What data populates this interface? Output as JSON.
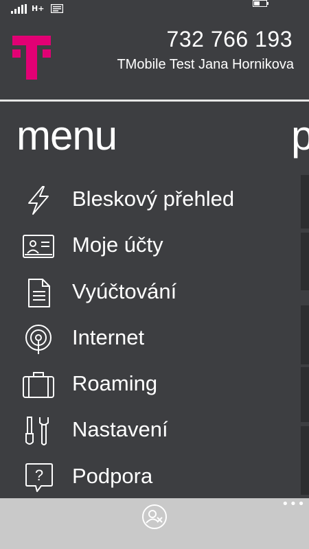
{
  "status_bar": {
    "network_type": "H+"
  },
  "header": {
    "phone_number": "732 766 193",
    "account_name": "TMobile Test Jana Hornikova"
  },
  "menu": {
    "title": "menu",
    "next_pivot_partial": "p",
    "items": [
      {
        "label": "Bleskový přehled",
        "icon": "lightning-icon"
      },
      {
        "label": "Moje účty",
        "icon": "id-card-icon"
      },
      {
        "label": "Vyúčtování",
        "icon": "document-icon"
      },
      {
        "label": "Internet",
        "icon": "signal-broadcast-icon"
      },
      {
        "label": "Roaming",
        "icon": "suitcase-icon"
      },
      {
        "label": "Nastavení",
        "icon": "tools-icon"
      },
      {
        "label": "Podpora",
        "icon": "help-bubble-icon"
      }
    ]
  },
  "app_bar": {
    "more": "•••"
  },
  "colors": {
    "brand_magenta": "#e20074",
    "background": "#3d3e41",
    "app_bar": "#c9c9c9"
  }
}
